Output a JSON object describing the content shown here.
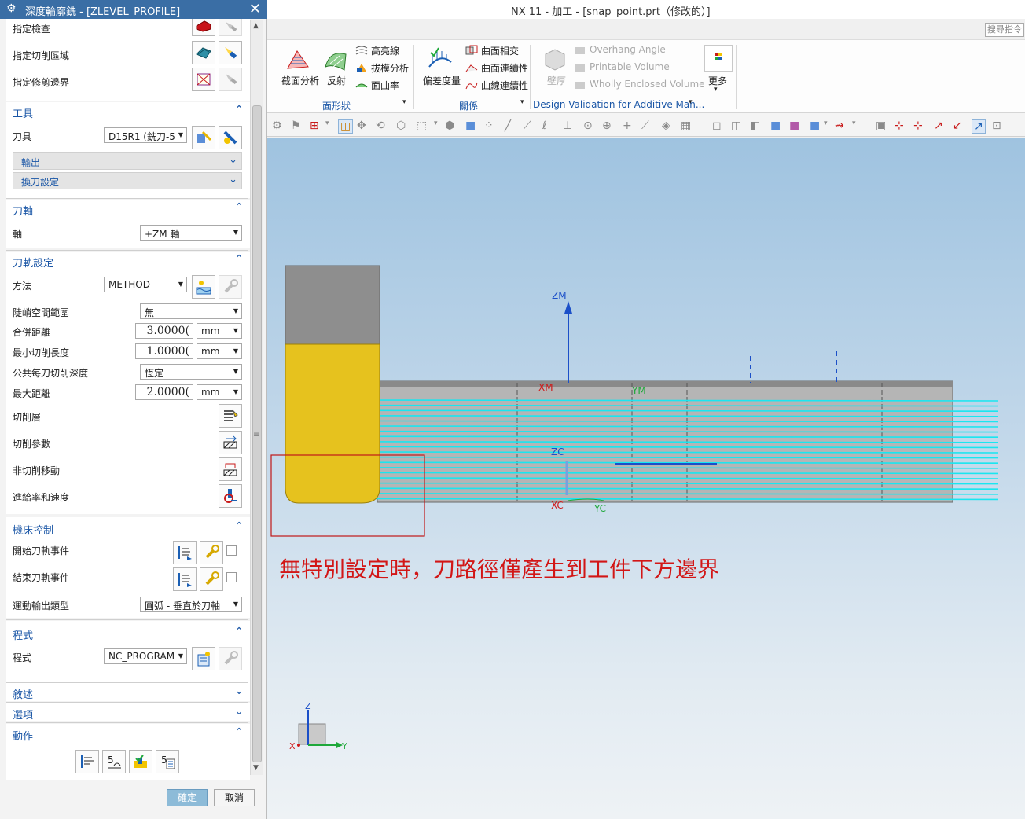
{
  "dialog": {
    "title": "深度輪廓銑 - [ZLEVEL_PROFILE]",
    "geometry_rows": [
      {
        "label": "指定檢查"
      },
      {
        "label": "指定切削區域"
      },
      {
        "label": "指定修剪邊界"
      }
    ],
    "tool_section": {
      "title": "工具",
      "tool_label": "刀具",
      "tool_value": "D15R1 (銑刀-5",
      "sub_output": "輸出",
      "sub_toolchange": "換刀設定"
    },
    "axis_section": {
      "title": "刀軸",
      "axis_label": "軸",
      "axis_value": "+ZM 軸"
    },
    "path_section": {
      "title": "刀軌設定",
      "method_label": "方法",
      "method_value": "METHOD",
      "steep_label": "陡峭空間範圍",
      "steep_value": "無",
      "merge_label": "合併距離",
      "merge_value": "3.0000(",
      "merge_unit": "mm",
      "minlen_label": "最小切削長度",
      "minlen_value": "1.0000(",
      "minlen_unit": "mm",
      "depth_label": "公共每刀切削深度",
      "depth_value": "恆定",
      "maxdist_label": "最大距離",
      "maxdist_value": "2.0000(",
      "maxdist_unit": "mm",
      "cutlevels_label": "切削層",
      "cutparams_label": "切削參數",
      "noncut_label": "非切削移動",
      "feeds_label": "進給率和速度"
    },
    "machine_section": {
      "title": "機床控制",
      "start_label": "開始刀軌事件",
      "end_label": "結束刀軌事件",
      "motion_label": "運動輸出類型",
      "motion_value": "圓弧 - 垂直於刀軸"
    },
    "program_section": {
      "title": "程式",
      "program_label": "程式",
      "program_value": "NC_PROGRAM"
    },
    "desc_title": "敘述",
    "options_title": "選項",
    "actions_title": "動作",
    "ok": "確定",
    "cancel": "取消"
  },
  "window": {
    "title": "NX 11 - 加工 - [snap_point.prt（修改的）]",
    "search_placeholder": "搜尋指令"
  },
  "ribbon": {
    "section_analysis": "截面分析",
    "reflection": "反射",
    "highlight_lines": "高亮線",
    "draft_analysis": "拔模分析",
    "surface_curvature": "面曲率",
    "group_shape": "面形狀",
    "deviation_gauge": "偏差度量",
    "surface_intersection": "曲面相交",
    "surface_continuity": "曲面連續性",
    "curve_continuity": "曲線連續性",
    "group_relation": "關係",
    "thickness": "壁厚",
    "overhang_angle": "Overhang Angle",
    "printable_volume": "Printable Volume",
    "wholly_enclosed": "Wholly Enclosed Volume",
    "group_additive": "Design Validation for Additive Man...",
    "more": "更多"
  },
  "viewport": {
    "annotation": "無特別設定時，刀路徑僅產生到工件下方邊界",
    "label_zm": "ZM",
    "label_xm": "XM",
    "label_ym": "YM",
    "label_zc": "ZC",
    "label_xc": "XC",
    "label_yc": "YC",
    "triad_z": "Z",
    "triad_x": "X",
    "triad_y": "Y"
  },
  "colors": {
    "title_bar": "#3a6ea5",
    "section_header": "#1a56a6",
    "toolpath": "#19e6f0",
    "annotation": "#d21616",
    "tool_holder": "#8e8e8e",
    "tool_body": "#e6c21e"
  }
}
